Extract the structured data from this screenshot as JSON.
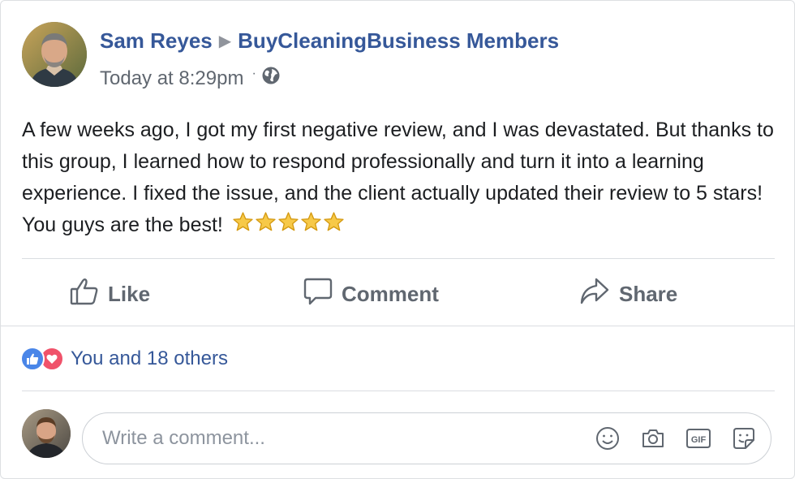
{
  "post": {
    "author": "Sam Reyes",
    "separator": "▶",
    "group": "BuyCleaningBusiness Members",
    "timestamp": "Today at 8:29pm",
    "meta_dot": "·",
    "privacy_icon": "globe-icon",
    "text": "A few weeks ago, I got my first negative review, and I was devastated. But thanks to this group, I learned how to respond professionally and turn it into a learning experience. I fixed the issue, and the client actually updated their review to 5 stars! You guys are the best!",
    "emoji": "star-emoji",
    "emoji_count": 5
  },
  "actions": {
    "like_label": "Like",
    "comment_label": "Comment",
    "share_label": "Share"
  },
  "reactions": {
    "icons": [
      "like-reaction-icon",
      "love-reaction-icon"
    ],
    "summary": "You and 18 others"
  },
  "comment": {
    "placeholder": "Write a comment...",
    "tools": [
      "emoji-icon",
      "camera-icon",
      "gif-icon",
      "sticker-icon"
    ]
  },
  "colors": {
    "link": "#365899",
    "muted": "#606770",
    "like": "#4a86e8",
    "love": "#f0526a",
    "divider": "#dadde1"
  }
}
